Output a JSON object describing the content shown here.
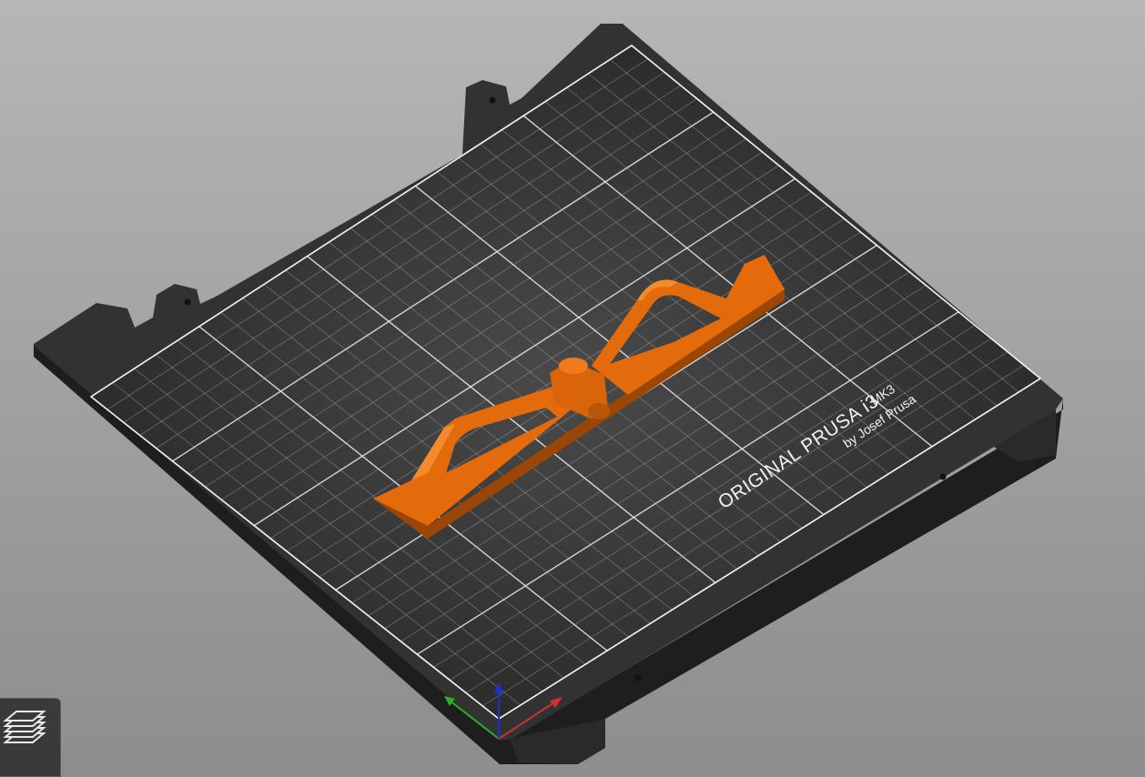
{
  "bed": {
    "brand_text": "ORIGINAL PRUSA i3",
    "model_text": "MK3",
    "maker_text": "by Josef Prusa"
  },
  "colors": {
    "background_top": "#b6b6b6",
    "background_bottom": "#8d8d8d",
    "bed_surface": "#2c2c2c",
    "bed_frame": "#3a3a3a",
    "grid_line": "#b0b0b0",
    "model_orange": "#e36b0c",
    "axis_x": "#d03030",
    "axis_y": "#2ab02a",
    "axis_z": "#2030c8"
  },
  "icons": {
    "layers": "layers-stack-icon",
    "axes": "xyz-axes-gizmo"
  }
}
